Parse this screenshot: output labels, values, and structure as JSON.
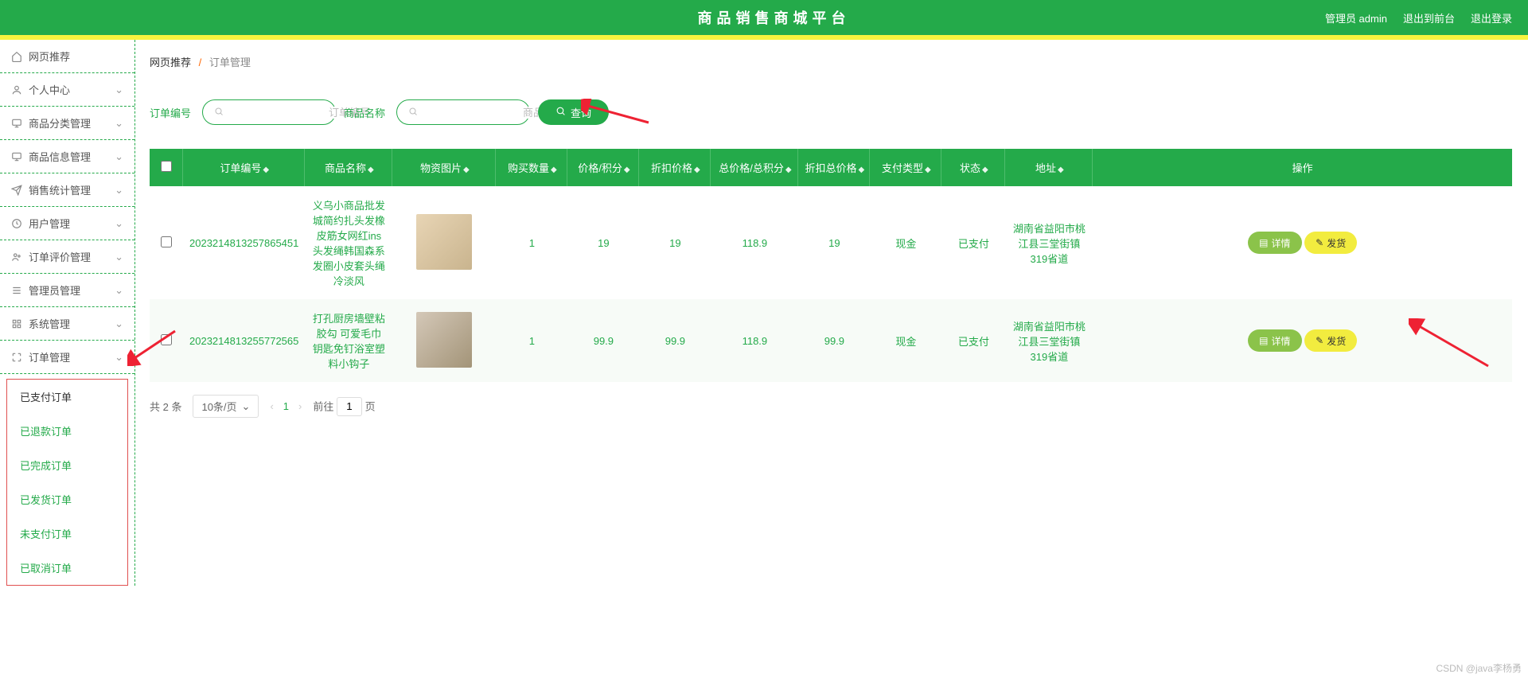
{
  "header": {
    "title": "商品销售商城平台",
    "user_label": "管理员 admin",
    "back_front": "退出到前台",
    "logout": "退出登录"
  },
  "sidebar": {
    "items": [
      {
        "icon": "home-icon",
        "label": "网页推荐",
        "expandable": false
      },
      {
        "icon": "user-icon",
        "label": "个人中心",
        "expandable": true
      },
      {
        "icon": "monitor-icon",
        "label": "商品分类管理",
        "expandable": true
      },
      {
        "icon": "monitor-icon",
        "label": "商品信息管理",
        "expandable": true
      },
      {
        "icon": "send-icon",
        "label": "销售统计管理",
        "expandable": true
      },
      {
        "icon": "clock-icon",
        "label": "用户管理",
        "expandable": true
      },
      {
        "icon": "users-icon",
        "label": "订单评价管理",
        "expandable": true
      },
      {
        "icon": "menu-icon",
        "label": "管理员管理",
        "expandable": true
      },
      {
        "icon": "cog-icon",
        "label": "系统管理",
        "expandable": true
      },
      {
        "icon": "expand-icon",
        "label": "订单管理",
        "expandable": true
      }
    ],
    "submenu": [
      "已支付订单",
      "已退款订单",
      "已完成订单",
      "已发货订单",
      "未支付订单",
      "已取消订单"
    ]
  },
  "breadcrumb": {
    "root": "网页推荐",
    "sep": "/",
    "current": "订单管理"
  },
  "search": {
    "order_label": "订单编号",
    "order_ph": "订单编号",
    "name_label": "商品名称",
    "name_ph": "商品名称",
    "query_btn": "查询"
  },
  "table": {
    "headers": [
      "",
      "订单编号",
      "商品名称",
      "物资图片",
      "购买数量",
      "价格/积分",
      "折扣价格",
      "总价格/总积分",
      "折扣总价格",
      "支付类型",
      "状态",
      "地址",
      "操作"
    ],
    "rows": [
      {
        "order_no": "2023214813257865451",
        "name": "义乌小商品批发城简约扎头发橡皮筋女网红ins头发绳韩国森系发圈小皮套头绳冷淡风",
        "qty": "1",
        "price": "19",
        "discount_price": "19",
        "total": "118.9",
        "discount_total": "19",
        "pay_type": "现金",
        "status": "已支付",
        "address": "湖南省益阳市桃江县三堂街镇319省道"
      },
      {
        "order_no": "2023214813255772565",
        "name": "打孔厨房墙壁粘胶勾 可爱毛巾钥匙免钉浴室塑料小钩子",
        "qty": "1",
        "price": "99.9",
        "discount_price": "99.9",
        "total": "118.9",
        "discount_total": "99.9",
        "pay_type": "现金",
        "status": "已支付",
        "address": "湖南省益阳市桃江县三堂街镇319省道"
      }
    ],
    "action_detail": "详情",
    "action_ship": "发货"
  },
  "pager": {
    "total_label": "共 2 条",
    "page_size": "10条/页",
    "current": "1",
    "goto_prefix": "前往",
    "goto_value": "1",
    "goto_suffix": "页"
  },
  "watermark": "CSDN @java李杨勇"
}
